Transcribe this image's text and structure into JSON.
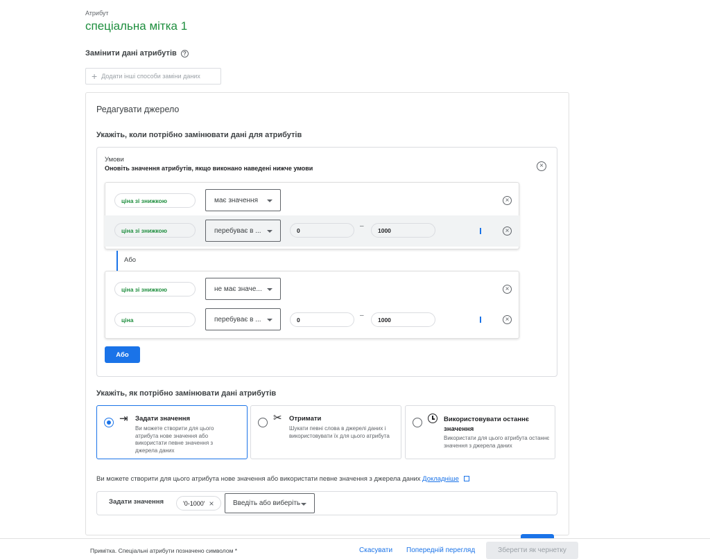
{
  "attribute": {
    "caption": "Атрибут",
    "name": "спеціальна мітка 1"
  },
  "replace": {
    "title": "Замінити дані атрибутів",
    "add_label": "Додати інші способи заміни даних"
  },
  "edit_source": {
    "title": "Редагувати джерело",
    "when_title": "Укажіть, коли потрібно замінювати дані для атрибутів",
    "conditions": {
      "label": "Умови",
      "description": "Оновіть значення атрибутів, якщо виконано наведені нижче умови",
      "or_label": "Або",
      "or_button": "Або",
      "groups": [
        {
          "rows": [
            {
              "attribute": "ціна зі знижкою",
              "operator": "має значення"
            },
            {
              "attribute": "ціна зі знижкою",
              "operator": "перебуває в ...",
              "from": "0",
              "to": "1000",
              "dash": "–"
            }
          ]
        },
        {
          "rows": [
            {
              "attribute": "ціна зі знижкою",
              "operator": "не має значе..."
            },
            {
              "attribute": "ціна",
              "operator": "перебуває в ...",
              "from": "0",
              "to": "1000",
              "dash": "–"
            }
          ]
        }
      ]
    },
    "how_title": "Укажіть, як потрібно замінювати дані атрибутів",
    "options": [
      {
        "title": "Задати значення",
        "description": "Ви можете створити для цього атрибута нове значення або використати певне значення з джерела даних",
        "icon": "set-value-icon",
        "selected": true
      },
      {
        "title": "Отримати",
        "description": "Шукати певні слова в джерелі даних і використовувати їх для цього атрибута",
        "icon": "scissors-icon",
        "selected": false
      },
      {
        "title": "Використовувати останнє значення",
        "description": "Використати для цього атрибута останнє значення з джерела даних",
        "icon": "clock-icon",
        "selected": false
      }
    ],
    "info_text": "Ви можете створити для цього атрибута нове значення або використати певне значення з джерела даних",
    "info_link": "Докладніше",
    "set_value": {
      "label": "Задати значення",
      "chip": "'0-1000'",
      "dropdown": "Введіть або виберіть"
    }
  },
  "footer": {
    "note": "Примітка. Спеціальні атрибути позначено символом *",
    "cancel": "Скасувати",
    "preview": "Попередній перегляд",
    "save_draft": "Зберегти як чернетку"
  },
  "colors": {
    "accent": "#1a73e8",
    "green": "#1e8e3e"
  }
}
